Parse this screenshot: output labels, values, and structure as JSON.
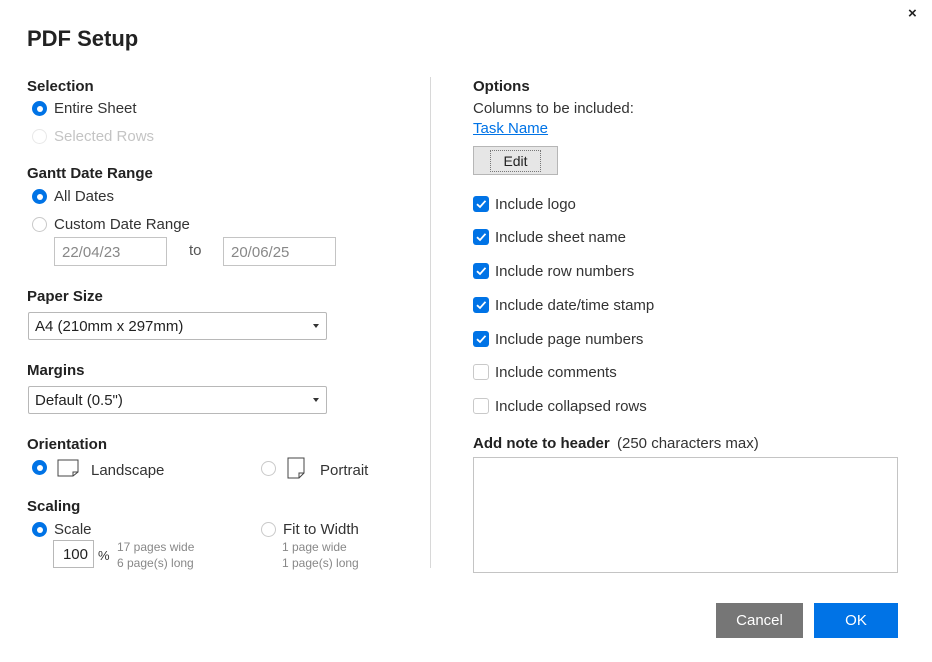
{
  "dialog": {
    "title": "PDF Setup",
    "close_symbol": "×"
  },
  "selection": {
    "heading": "Selection",
    "options": [
      "Entire Sheet",
      "Selected Rows"
    ],
    "selected": "Entire Sheet"
  },
  "gantt": {
    "heading": "Gantt Date Range",
    "options": [
      "All Dates",
      "Custom Date Range"
    ],
    "selected": "All Dates",
    "from_date": "22/04/23",
    "to_label": "to",
    "to_date": "20/06/25"
  },
  "paper_size": {
    "heading": "Paper Size",
    "value": "A4 (210mm x 297mm)"
  },
  "margins": {
    "heading": "Margins",
    "value": "Default (0.5\")"
  },
  "orientation": {
    "heading": "Orientation",
    "options": [
      "Landscape",
      "Portrait"
    ],
    "selected": "Landscape"
  },
  "scaling": {
    "heading": "Scaling",
    "scale_label": "Scale",
    "scale_value": "100",
    "percent": "%",
    "scale_pages_wide": "17 pages wide",
    "scale_pages_long": "6 page(s) long",
    "fit_label": "Fit to Width",
    "fit_pages_wide": "1 page wide",
    "fit_pages_long": "1 page(s) long",
    "selected": "Scale"
  },
  "options": {
    "heading": "Options",
    "columns_label": "Columns to be included:",
    "column_link": "Task Name",
    "edit_label": "Edit",
    "checkboxes": [
      {
        "label": "Include logo",
        "checked": true
      },
      {
        "label": "Include sheet name",
        "checked": true
      },
      {
        "label": "Include row numbers",
        "checked": true
      },
      {
        "label": "Include date/time stamp",
        "checked": true
      },
      {
        "label": "Include page numbers",
        "checked": true
      },
      {
        "label": "Include comments",
        "checked": false
      },
      {
        "label": "Include collapsed rows",
        "checked": false
      }
    ]
  },
  "note": {
    "heading": "Add note to header",
    "hint": "(250 characters max)",
    "value": ""
  },
  "footer": {
    "cancel_label": "Cancel",
    "ok_label": "OK"
  },
  "colors": {
    "accent": "#0073e6",
    "cancel_bg": "#767676"
  }
}
